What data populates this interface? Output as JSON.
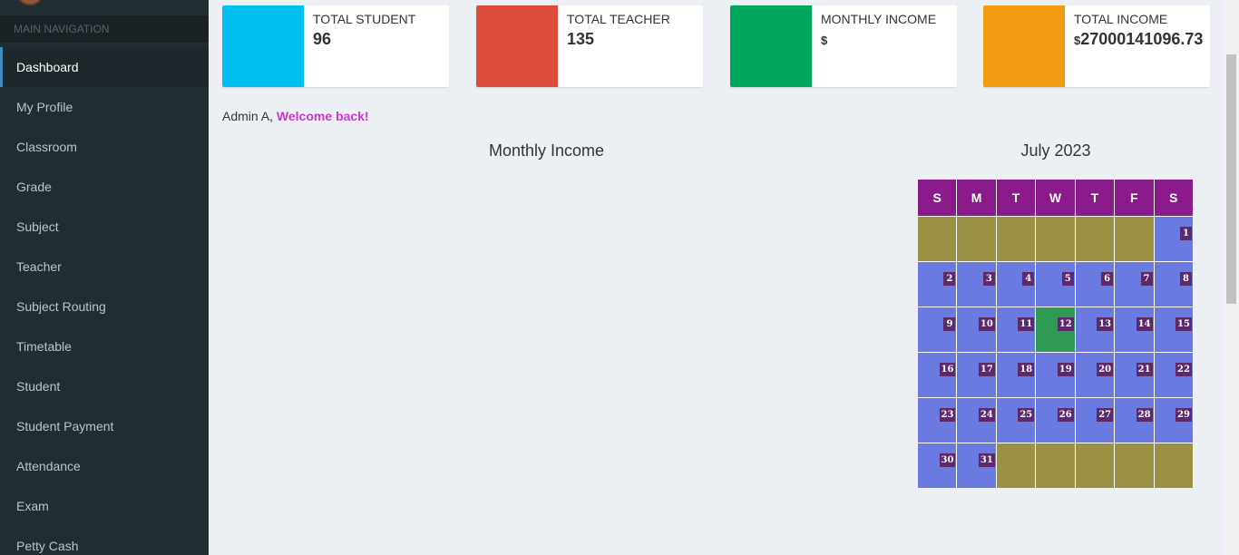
{
  "sidebar": {
    "header": "MAIN NAVIGATION",
    "items": [
      {
        "label": "Dashboard"
      },
      {
        "label": "My Profile"
      },
      {
        "label": "Classroom"
      },
      {
        "label": "Grade"
      },
      {
        "label": "Subject"
      },
      {
        "label": "Teacher"
      },
      {
        "label": "Subject Routing"
      },
      {
        "label": "Timetable"
      },
      {
        "label": "Student"
      },
      {
        "label": "Student Payment"
      },
      {
        "label": "Attendance"
      },
      {
        "label": "Exam"
      },
      {
        "label": "Petty Cash"
      }
    ]
  },
  "stats": [
    {
      "label": "TOTAL STUDENT",
      "value": "96",
      "currency": "",
      "color": "#00c0ef"
    },
    {
      "label": "TOTAL TEACHER",
      "value": "135",
      "currency": "",
      "color": "#dd4b39"
    },
    {
      "label": "MONTHLY INCOME",
      "value": "",
      "currency": "$",
      "color": "#00a65a"
    },
    {
      "label": "TOTAL INCOME",
      "value": "27000141096.73",
      "currency": "$",
      "color": "#f39c12"
    }
  ],
  "welcome": {
    "user": "Admin A,",
    "message": "Welcome back!"
  },
  "chart": {
    "title": "Monthly Income"
  },
  "calendar": {
    "title": "July 2023",
    "weekdays": [
      "S",
      "M",
      "T",
      "W",
      "T",
      "F",
      "S"
    ],
    "weeks": [
      [
        "",
        "",
        "",
        "",
        "",
        "",
        "1"
      ],
      [
        "2",
        "3",
        "4",
        "5",
        "6",
        "7",
        "8"
      ],
      [
        "9",
        "10",
        "11",
        "12",
        "13",
        "14",
        "15"
      ],
      [
        "16",
        "17",
        "18",
        "19",
        "20",
        "21",
        "22"
      ],
      [
        "23",
        "24",
        "25",
        "26",
        "27",
        "28",
        "29"
      ],
      [
        "30",
        "31",
        "",
        "",
        "",
        "",
        ""
      ]
    ],
    "today": "12"
  }
}
